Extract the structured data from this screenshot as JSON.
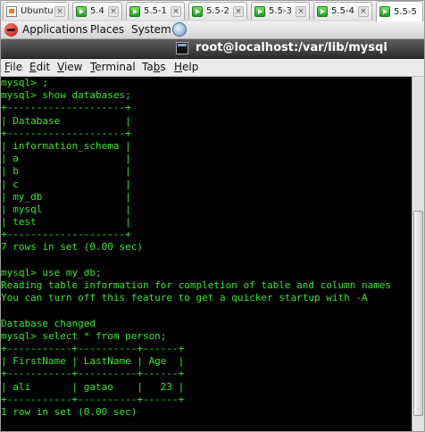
{
  "tabs": [
    {
      "label": "Ubuntu",
      "icon": "ubuntu-icon"
    },
    {
      "label": "5.4",
      "icon": "play-icon"
    },
    {
      "label": "5.5-1",
      "icon": "play-icon"
    },
    {
      "label": "5.5-2",
      "icon": "play-icon"
    },
    {
      "label": "5.5-3",
      "icon": "play-icon"
    },
    {
      "label": "5.5-4",
      "icon": "play-icon"
    },
    {
      "label": "5.5-5",
      "icon": "play-icon",
      "active": true
    }
  ],
  "tab_close_glyph": "×",
  "panel": {
    "applications": "Applications",
    "places": "Places",
    "system": "System"
  },
  "window": {
    "title": "root@localhost:/var/lib/mysql"
  },
  "menubar": {
    "file": "File",
    "edit": "Edit",
    "view": "View",
    "terminal": "Terminal",
    "tabs": "Tabs",
    "help": "Help"
  },
  "terminal": {
    "text_color": "#39e62a",
    "background": "#000000",
    "lines": [
      "mysql> ;",
      "mysql> show databases;",
      "+--------------------+",
      "| Database           |",
      "+--------------------+",
      "| information_schema |",
      "| a                  |",
      "| b                  |",
      "| c                  |",
      "| my_db              |",
      "| mysql              |",
      "| test               |",
      "+--------------------+",
      "7 rows in set (0.00 sec)",
      "",
      "mysql> use my_db;",
      "Reading table information for completion of table and column names",
      "You can turn off this feature to get a quicker startup with -A",
      "",
      "Database changed",
      "mysql> select * from person;",
      "+-----------+----------+------+",
      "| FirstName | LastName | Age  |",
      "+-----------+----------+------+",
      "| ali       | gatao    |   23 |",
      "+-----------+----------+------+",
      "1 row in set (0.00 sec)"
    ]
  }
}
